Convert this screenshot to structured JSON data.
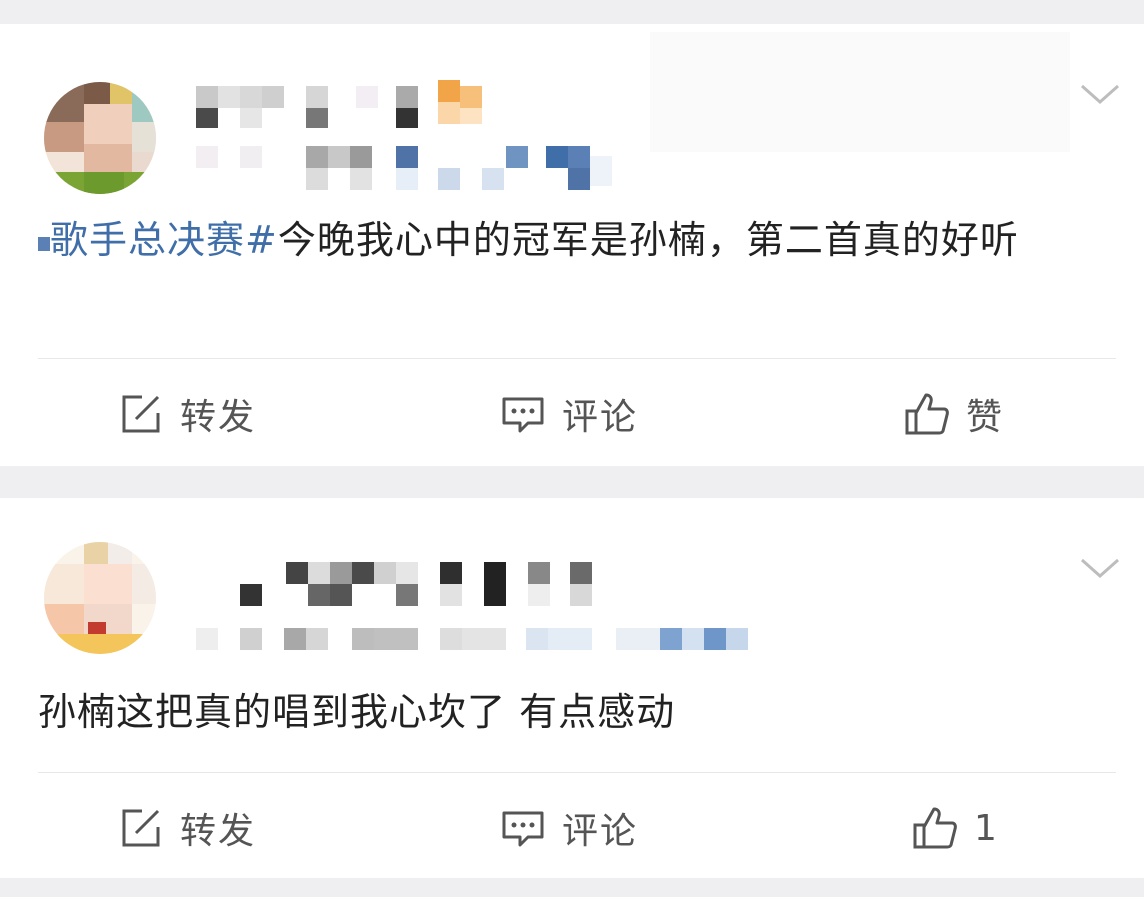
{
  "feed": {
    "posts": [
      {
        "text_topic": "歌手总决赛#",
        "text_body": "今晚我心中的冠军是孙楠，第二首真的好听",
        "actions": {
          "repost_label": "转发",
          "comment_label": "评论",
          "like_label": "赞"
        }
      },
      {
        "text_body": "孙楠这把真的唱到我心坎了 有点感动",
        "actions": {
          "repost_label": "转发",
          "comment_label": "评论",
          "like_label": "1"
        }
      }
    ]
  },
  "colors": {
    "topic_link": "#3f6ea8",
    "action_text": "#555555",
    "background": "#efeff1",
    "card": "#ffffff"
  },
  "icons": {
    "repost": "edit-square-icon",
    "comment": "comment-bubble-icon",
    "like": "thumbs-up-icon",
    "more": "chevron-down-icon"
  }
}
